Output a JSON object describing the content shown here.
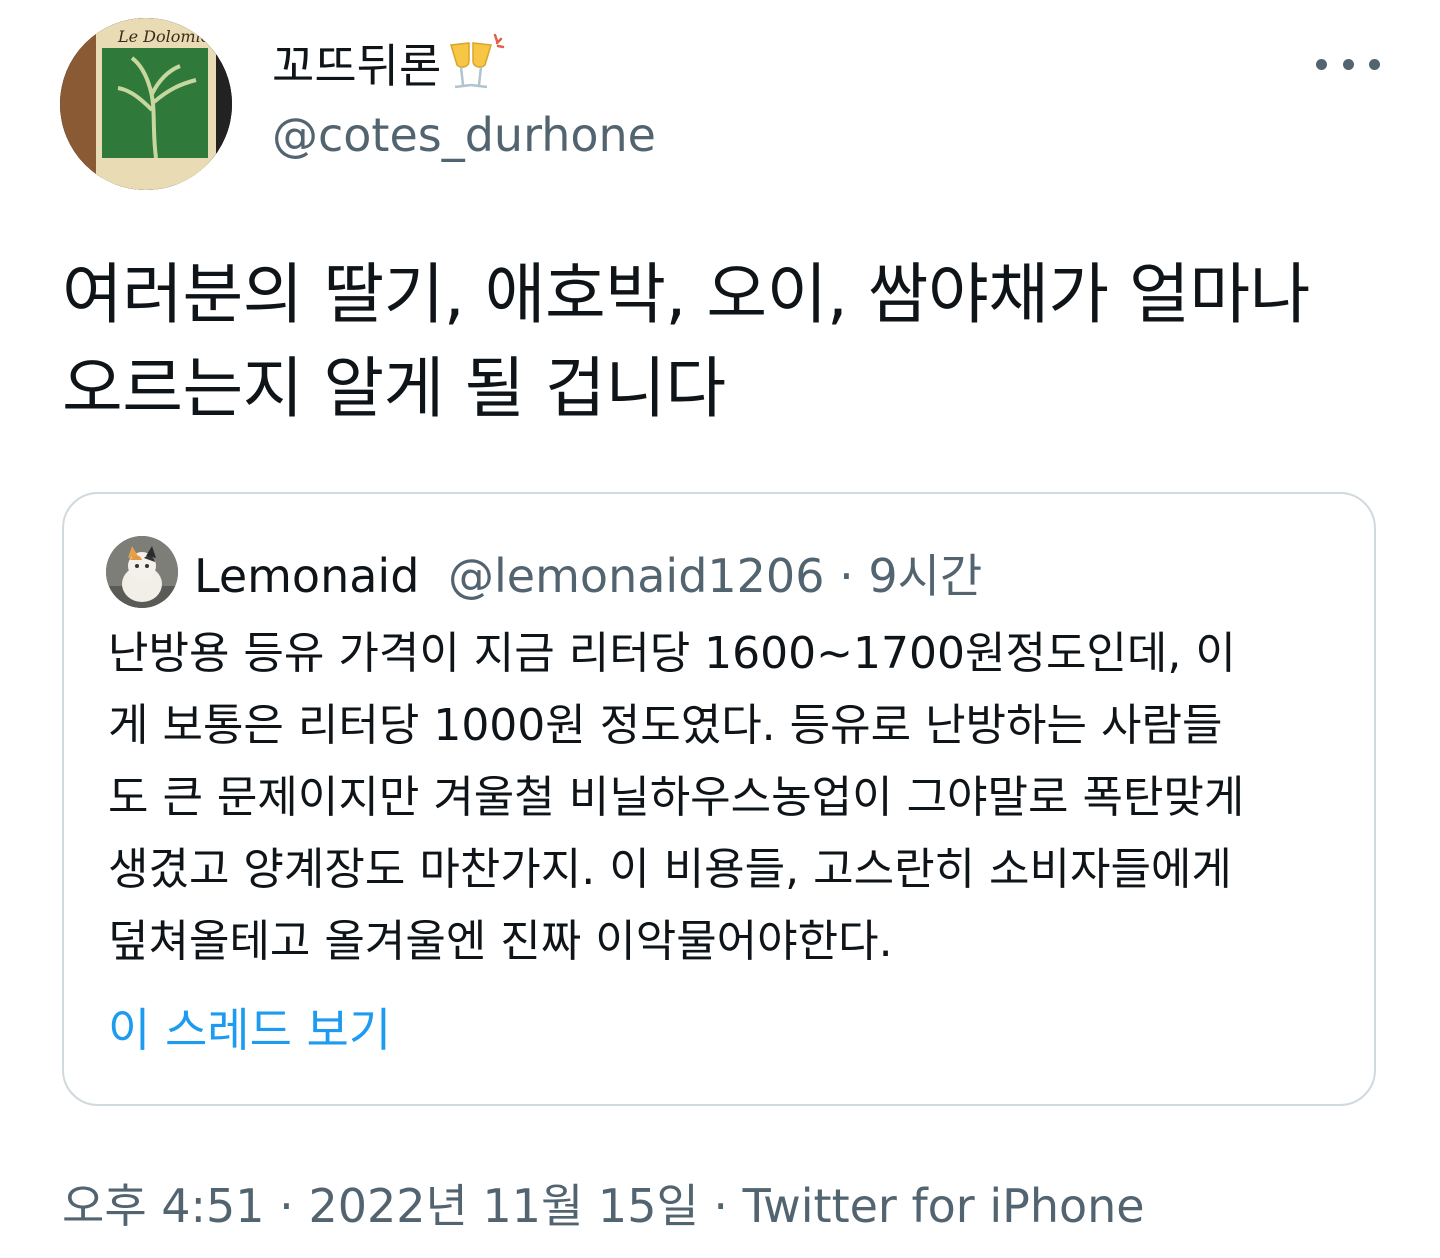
{
  "author": {
    "display_name": "꼬뜨뒤론",
    "emoji_icon": "clinking-glasses-icon",
    "handle": "@cotes_durhone",
    "avatar_icon": "wine-bottle-avatar"
  },
  "more_icon": "more-options-icon",
  "tweet": {
    "text": "여러분의 딸기, 애호박, 오이, 쌈야채가 얼마나 오르는지 알게 될 겁니다"
  },
  "quote": {
    "name": "Lemonaid",
    "handle": "@lemonaid1206",
    "separator": " · ",
    "time": "9시간",
    "avatar_icon": "cat-avatar",
    "lines": [
      "난방용 등유 가격이 지금 리터당 1600~1700원정도인데, 이",
      "게 보통은 리터당 1000원 정도였다. 등유로 난방하는 사람들",
      "도 큰 문제이지만 겨울철 비닐하우스농업이 그야말로 폭탄맞게",
      "생겼고 양계장도 마찬가지. 이 비용들, 고스란히 소비자들에게",
      "덮쳐올테고 올겨울엔 진짜 이악물어야한다."
    ],
    "show_thread": "이 스레드 보기"
  },
  "meta": {
    "time": "오후 4:51",
    "separator": " · ",
    "date": "2022년 11월 15일",
    "separator2": " · ",
    "source": "Twitter for iPhone"
  },
  "colors": {
    "text_primary": "#0f1419",
    "text_secondary": "#536471",
    "link": "#1d9bf0",
    "border": "#cfd9de"
  }
}
